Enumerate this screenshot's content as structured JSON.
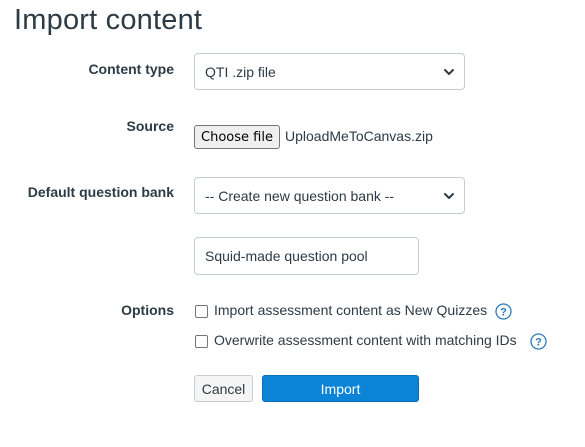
{
  "page": {
    "title": "Import content"
  },
  "form": {
    "content_type": {
      "label": "Content type",
      "selected": "QTI .zip file"
    },
    "source": {
      "label": "Source",
      "button": "Choose file",
      "file_name": "UploadMeToCanvas.zip"
    },
    "question_bank": {
      "label": "Default question bank",
      "selected": "-- Create new question bank --",
      "new_bank_name": "Squid-made question pool"
    },
    "options": {
      "label": "Options",
      "items": [
        {
          "label": "Import assessment content as New Quizzes",
          "checked": false
        },
        {
          "label": "Overwrite assessment content with matching IDs",
          "checked": false
        }
      ]
    }
  },
  "actions": {
    "cancel": "Cancel",
    "import": "Import"
  },
  "icons": {
    "dropdown": "chevron-down-icon",
    "help": "question-circle-icon"
  },
  "colors": {
    "primary": "#0b84d8",
    "help": "#2b7abc",
    "text": "#2d3b45"
  }
}
